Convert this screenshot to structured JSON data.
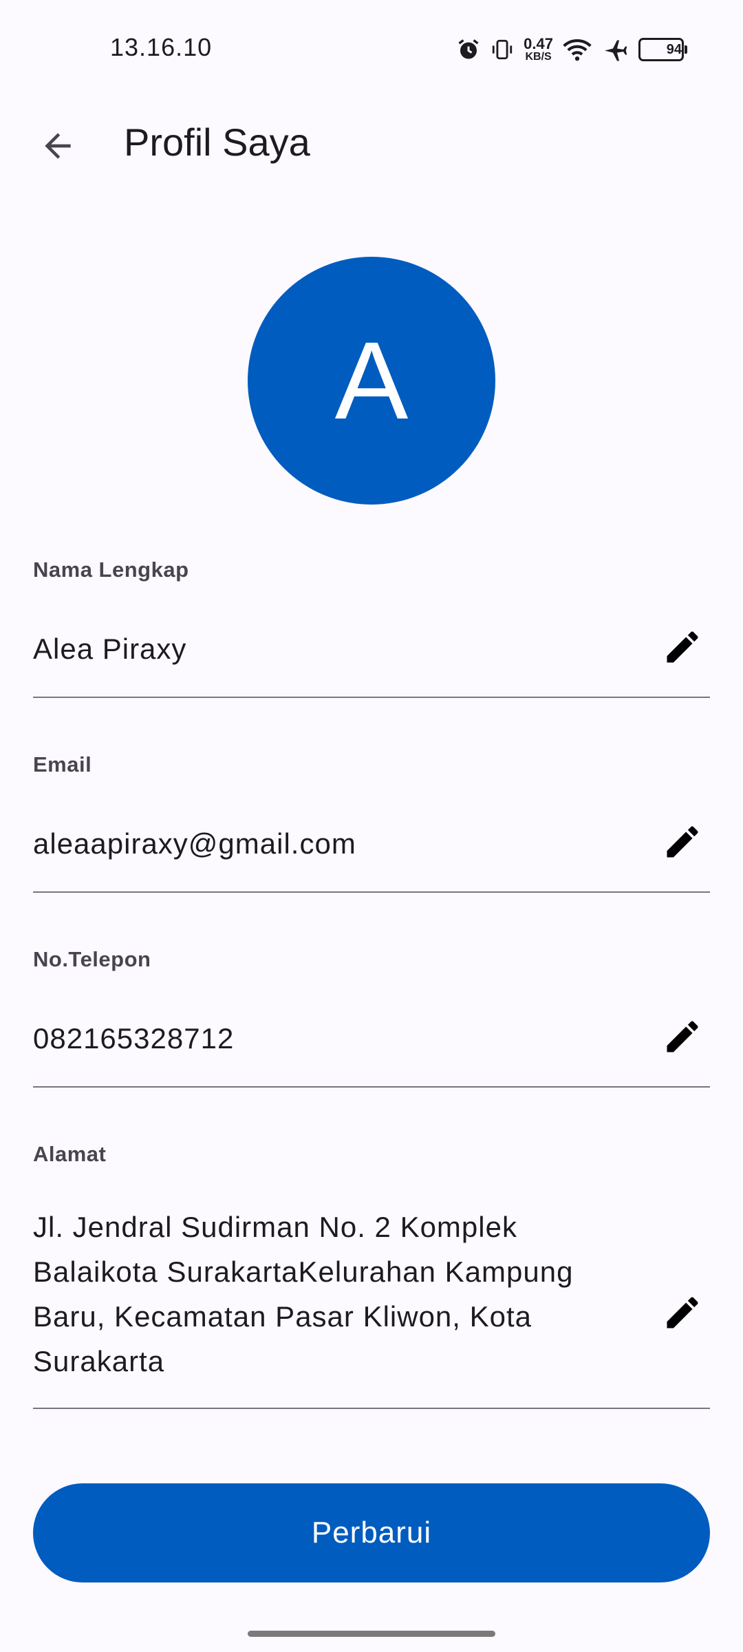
{
  "status_bar": {
    "time": "13.16.10",
    "net_speed_value": "0.47",
    "net_speed_unit": "KB/S",
    "battery_level": "94",
    "icons": [
      "alarm-icon",
      "vibrate-icon",
      "wifi-icon",
      "airplane-icon",
      "battery-icon"
    ]
  },
  "app_bar": {
    "back_icon": "arrow-back-icon",
    "title": "Profil Saya"
  },
  "avatar": {
    "initial": "A",
    "color": "#005cbf"
  },
  "fields": [
    {
      "label": "Nama Lengkap",
      "value": "Alea Piraxy",
      "edit_icon": "pencil-icon"
    },
    {
      "label": "Email",
      "value": "aleaapiraxy@gmail.com",
      "edit_icon": "pencil-icon"
    },
    {
      "label": "No.Telepon",
      "value": "082165328712",
      "edit_icon": "pencil-icon"
    },
    {
      "label": "Alamat",
      "value": "Jl. Jendral Sudirman No. 2 Komplek Balaikota SurakartaKelurahan Kampung Baru, Kecamatan Pasar Kliwon, Kota Surakarta",
      "edit_icon": "pencil-icon"
    }
  ],
  "update_button": {
    "label": "Perbarui",
    "color": "#005cbf"
  }
}
